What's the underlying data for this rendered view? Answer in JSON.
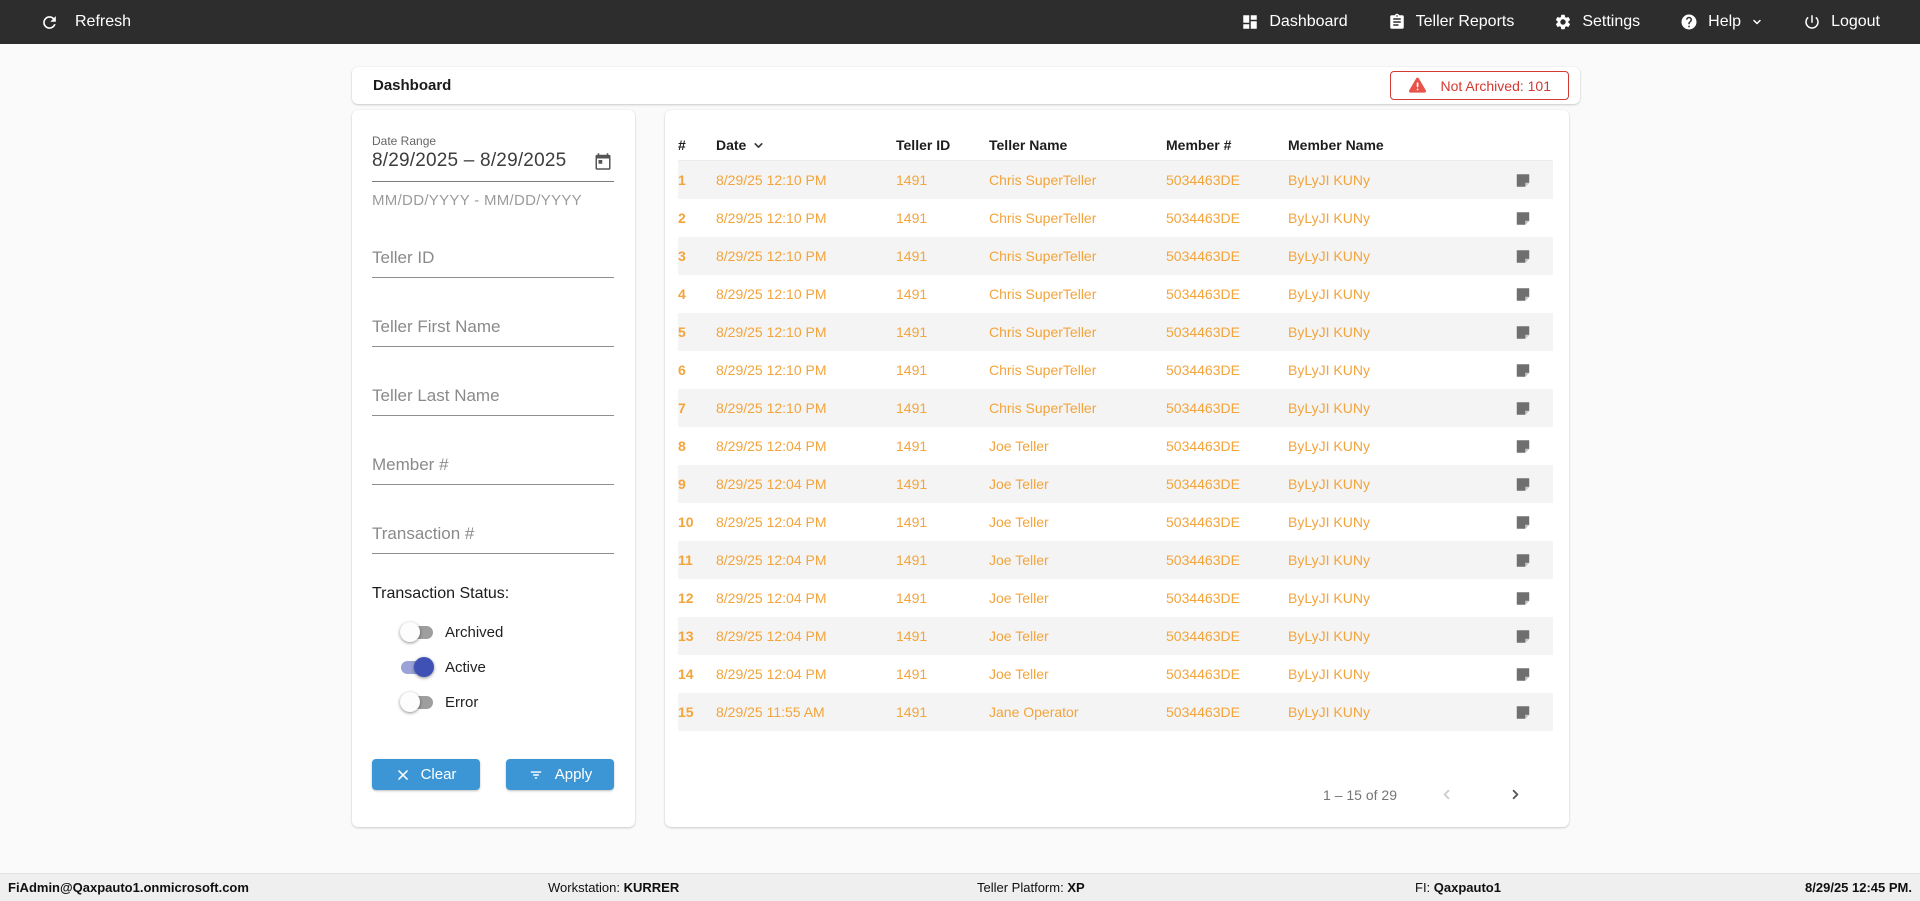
{
  "nav": {
    "refresh_label": "Refresh",
    "items": [
      {
        "label": "Dashboard",
        "icon": "dashboard-icon"
      },
      {
        "label": "Teller Reports",
        "icon": "clipboard-icon"
      },
      {
        "label": "Settings",
        "icon": "gear-icon"
      },
      {
        "label": "Help",
        "icon": "help-icon",
        "has_dropdown": true
      },
      {
        "label": "Logout",
        "icon": "power-icon"
      }
    ]
  },
  "header": {
    "title": "Dashboard",
    "alert_badge": "Not Archived: 101"
  },
  "filters": {
    "date_range": {
      "label": "Date Range",
      "value": "8/29/2025 – 8/29/2025",
      "hint": "MM/DD/YYYY - MM/DD/YYYY"
    },
    "fields": [
      {
        "placeholder": "Teller ID"
      },
      {
        "placeholder": "Teller First Name"
      },
      {
        "placeholder": "Teller Last Name"
      },
      {
        "placeholder": "Member #"
      },
      {
        "placeholder": "Transaction #"
      }
    ],
    "status": {
      "label": "Transaction Status:",
      "toggles": [
        {
          "label": "Archived",
          "on": false
        },
        {
          "label": "Active",
          "on": true
        },
        {
          "label": "Error",
          "on": false
        }
      ]
    },
    "clear_label": "Clear",
    "apply_label": "Apply"
  },
  "table": {
    "columns": [
      "#",
      "Date",
      "Teller ID",
      "Teller Name",
      "Member #",
      "Member Name"
    ],
    "sorted_column": "Date",
    "sort_direction": "desc",
    "rows": [
      {
        "num": "1",
        "date": "8/29/25 12:10 PM",
        "teller_id": "1491",
        "teller_name": "Chris SuperTeller",
        "member_num": "5034463DE",
        "member_name": "ByLyJI KUNy"
      },
      {
        "num": "2",
        "date": "8/29/25 12:10 PM",
        "teller_id": "1491",
        "teller_name": "Chris SuperTeller",
        "member_num": "5034463DE",
        "member_name": "ByLyJI KUNy"
      },
      {
        "num": "3",
        "date": "8/29/25 12:10 PM",
        "teller_id": "1491",
        "teller_name": "Chris SuperTeller",
        "member_num": "5034463DE",
        "member_name": "ByLyJI KUNy"
      },
      {
        "num": "4",
        "date": "8/29/25 12:10 PM",
        "teller_id": "1491",
        "teller_name": "Chris SuperTeller",
        "member_num": "5034463DE",
        "member_name": "ByLyJI KUNy"
      },
      {
        "num": "5",
        "date": "8/29/25 12:10 PM",
        "teller_id": "1491",
        "teller_name": "Chris SuperTeller",
        "member_num": "5034463DE",
        "member_name": "ByLyJI KUNy"
      },
      {
        "num": "6",
        "date": "8/29/25 12:10 PM",
        "teller_id": "1491",
        "teller_name": "Chris SuperTeller",
        "member_num": "5034463DE",
        "member_name": "ByLyJI KUNy"
      },
      {
        "num": "7",
        "date": "8/29/25 12:10 PM",
        "teller_id": "1491",
        "teller_name": "Chris SuperTeller",
        "member_num": "5034463DE",
        "member_name": "ByLyJI KUNy"
      },
      {
        "num": "8",
        "date": "8/29/25 12:04 PM",
        "teller_id": "1491",
        "teller_name": "Joe Teller",
        "member_num": "5034463DE",
        "member_name": "ByLyJI KUNy"
      },
      {
        "num": "9",
        "date": "8/29/25 12:04 PM",
        "teller_id": "1491",
        "teller_name": "Joe Teller",
        "member_num": "5034463DE",
        "member_name": "ByLyJI KUNy"
      },
      {
        "num": "10",
        "date": "8/29/25 12:04 PM",
        "teller_id": "1491",
        "teller_name": "Joe Teller",
        "member_num": "5034463DE",
        "member_name": "ByLyJI KUNy"
      },
      {
        "num": "11",
        "date": "8/29/25 12:04 PM",
        "teller_id": "1491",
        "teller_name": "Joe Teller",
        "member_num": "5034463DE",
        "member_name": "ByLyJI KUNy"
      },
      {
        "num": "12",
        "date": "8/29/25 12:04 PM",
        "teller_id": "1491",
        "teller_name": "Joe Teller",
        "member_num": "5034463DE",
        "member_name": "ByLyJI KUNy"
      },
      {
        "num": "13",
        "date": "8/29/25 12:04 PM",
        "teller_id": "1491",
        "teller_name": "Joe Teller",
        "member_num": "5034463DE",
        "member_name": "ByLyJI KUNy"
      },
      {
        "num": "14",
        "date": "8/29/25 12:04 PM",
        "teller_id": "1491",
        "teller_name": "Joe Teller",
        "member_num": "5034463DE",
        "member_name": "ByLyJI KUNy"
      },
      {
        "num": "15",
        "date": "8/29/25 11:55 AM",
        "teller_id": "1491",
        "teller_name": "Jane Operator",
        "member_num": "5034463DE",
        "member_name": "ByLyJI KUNy"
      }
    ],
    "row_action_icon": "note-icon",
    "pagination": {
      "range_label": "1 – 15 of 29",
      "prev_enabled": false,
      "next_enabled": true
    }
  },
  "footer": {
    "user": "FiAdmin@Qaxpauto1.onmicrosoft.com",
    "workstation_label": "Workstation: ",
    "workstation_value": "KURRER",
    "platform_label": "Teller Platform: ",
    "platform_value": "XP",
    "fi_label": "FI: ",
    "fi_value": "Qaxpauto1",
    "timestamp": "8/29/25 12:45 PM."
  },
  "colors": {
    "nav_background": "#2d2d2d",
    "accent_blue": "#3c96d6",
    "toggle_active_indigo": "#3f51b5",
    "row_text_orange": "#f3a43b",
    "alert_red": "#d23a32",
    "stripe_gray": "#f4f4f4"
  }
}
